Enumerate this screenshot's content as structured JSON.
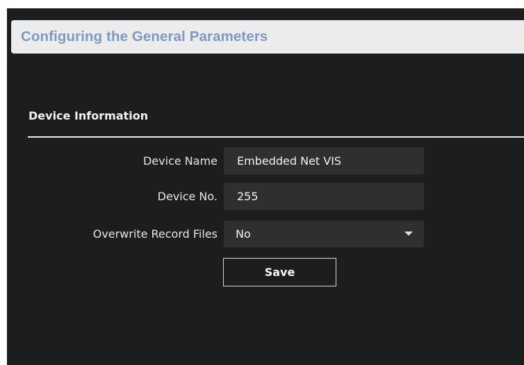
{
  "page": {
    "title": "Configuring the General Parameters"
  },
  "section": {
    "title": "Device Information"
  },
  "form": {
    "device_name": {
      "label": "Device Name",
      "value": "Embedded Net VIS"
    },
    "device_no": {
      "label": "Device No.",
      "value": "255"
    },
    "overwrite_record_files": {
      "label": "Overwrite Record Files",
      "selected": "No"
    },
    "save_label": "Save"
  },
  "colors": {
    "panel_background": "#1c1d1f",
    "field_background": "#2e2f31",
    "title_bar_background": "#ececec",
    "title_text": "#7d9bc1",
    "text": "#e6e6e6"
  },
  "icons": {
    "dropdown": "chevron-down-icon"
  }
}
